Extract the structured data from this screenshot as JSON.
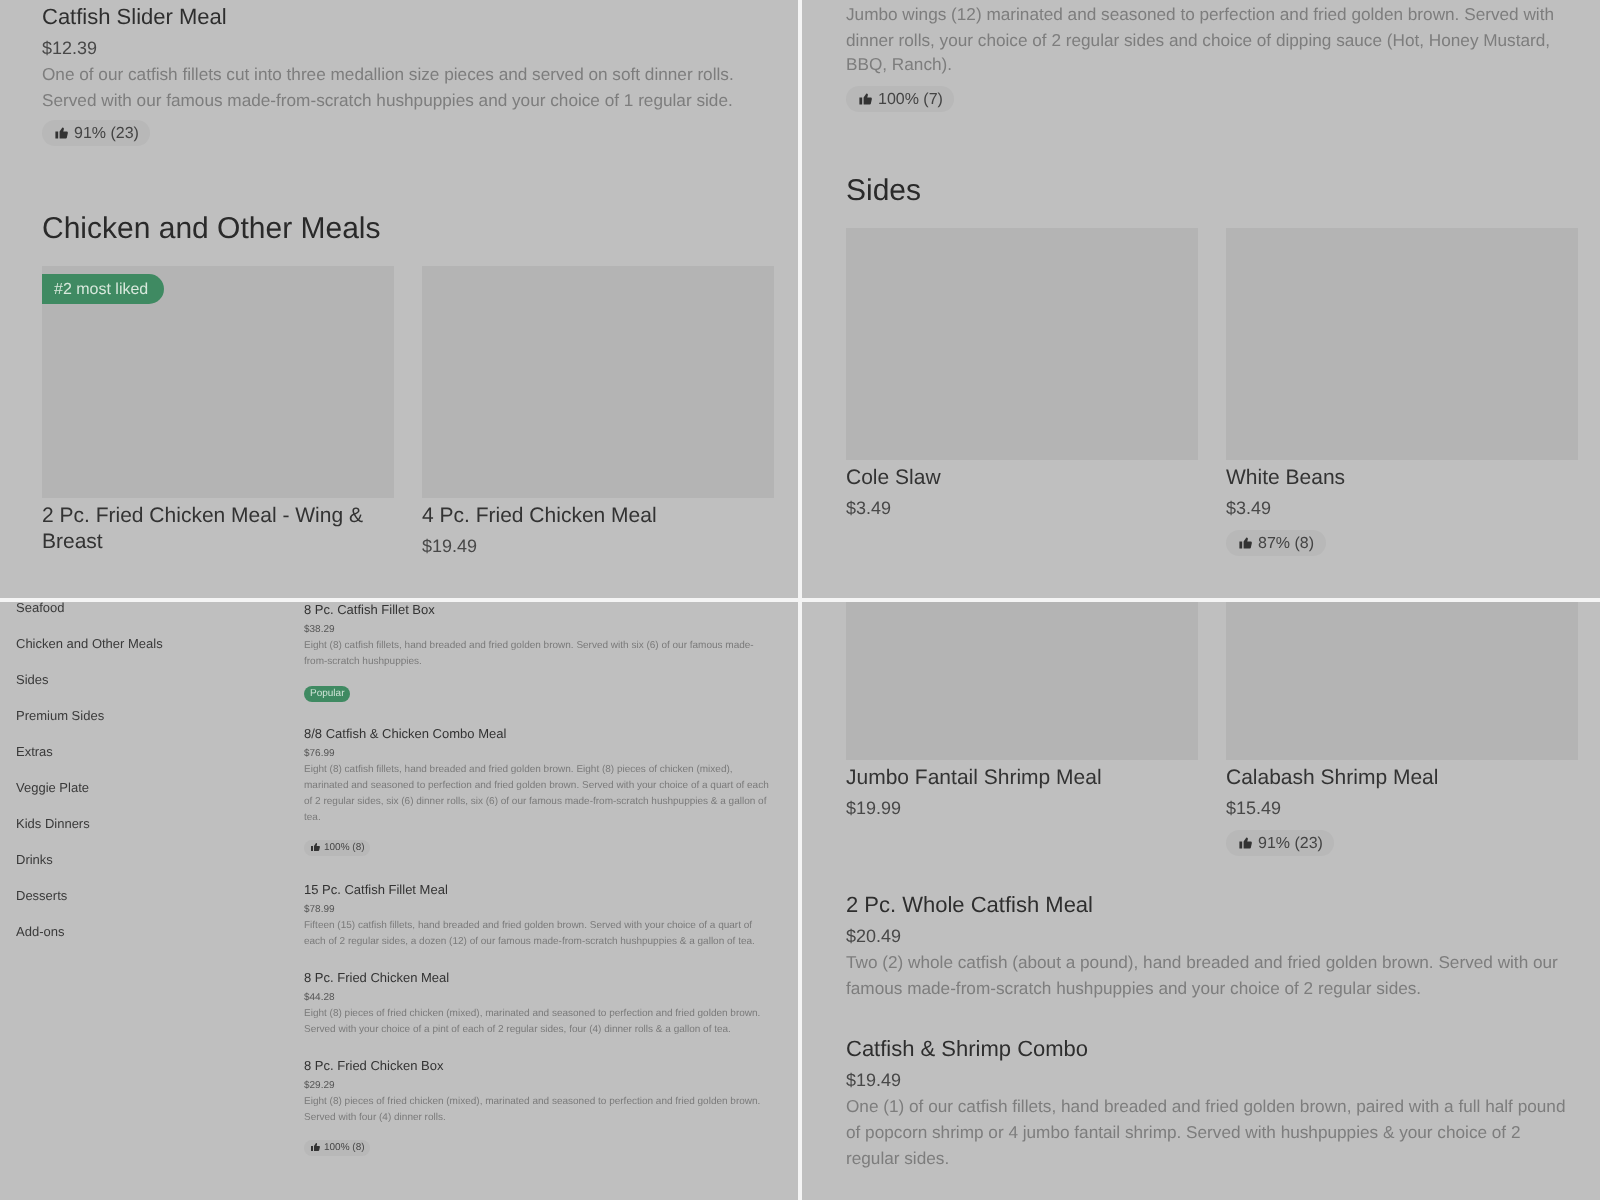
{
  "panels": [
    {
      "kind": "menu",
      "blocks": [
        {
          "kind": "item",
          "name": "Catfish Slider Meal",
          "price": "$12.39",
          "description": "One of our catfish fillets cut into three medallion size pieces and served on soft dinner rolls. Served with our famous made-from-scratch hushpuppies and your choice of 1 regular side.",
          "rating": "91% (23)"
        },
        {
          "kind": "heading",
          "text": "Chicken and Other Meals"
        },
        {
          "kind": "cards",
          "cards": [
            {
              "name": "2 Pc. Fried Chicken Meal - Wing & Breast",
              "badge": "#2 most liked"
            },
            {
              "name": "4 Pc. Fried Chicken Meal",
              "price": "$19.49"
            }
          ]
        }
      ]
    },
    {
      "kind": "menu",
      "blocks": [
        {
          "kind": "item",
          "description": "Jumbo wings (12) marinated and seasoned to perfection and fried golden brown. Served with dinner rolls, your choice of 2 regular sides and choice of dipping sauce (Hot, Honey Mustard, BBQ, Ranch).",
          "rating": "100% (7)"
        },
        {
          "kind": "heading",
          "text": "Sides"
        },
        {
          "kind": "cards",
          "cards": [
            {
              "name": "Cole Slaw",
              "price": "$3.49"
            },
            {
              "name": "White Beans",
              "price": "$3.49",
              "rating": "87% (8)"
            }
          ]
        }
      ]
    },
    {
      "kind": "compact",
      "categories": [
        "Seafood",
        "Chicken and Other Meals",
        "Sides",
        "Premium Sides",
        "Extras",
        "Veggie Plate",
        "Kids Dinners",
        "Drinks",
        "Desserts",
        "Add-ons"
      ],
      "items": [
        {
          "name": "8 Pc. Catfish Fillet Box",
          "price": "$38.29",
          "description": "Eight (8) catfish fillets, hand breaded and fried golden brown. Served with six (6) of our famous made-from-scratch hushpuppies.",
          "badge": "Popular"
        },
        {
          "name": "8/8 Catfish & Chicken Combo Meal",
          "price": "$76.99",
          "description": "Eight (8) catfish fillets, hand breaded and fried golden brown. Eight (8) pieces of chicken (mixed), marinated and seasoned to perfection and fried golden brown. Served with your choice of a quart of each of 2 regular sides, six (6) dinner rolls, six (6) of our famous made-from-scratch hushpuppies & a gallon of tea.",
          "rating": "100% (8)"
        },
        {
          "name": "15 Pc. Catfish Fillet Meal",
          "price": "$78.99",
          "description": "Fifteen (15) catfish fillets, hand breaded and fried golden brown. Served with your choice of a quart of each of 2 regular sides, a dozen (12) of our famous made-from-scratch hushpuppies & a gallon of tea."
        },
        {
          "name": "8 Pc. Fried Chicken Meal",
          "price": "$44.28",
          "description": "Eight (8) pieces of fried chicken (mixed), marinated and seasoned to perfection and fried golden brown. Served with your choice of a pint of each of 2 regular sides, four (4) dinner rolls & a gallon of tea."
        },
        {
          "name": "8 Pc. Fried Chicken Box",
          "price": "$29.29",
          "description": "Eight (8) pieces of fried chicken (mixed), marinated and seasoned to perfection and fried golden brown. Served with four (4) dinner rolls.",
          "rating": "100% (8)"
        }
      ]
    },
    {
      "kind": "menu",
      "blocks": [
        {
          "kind": "cards",
          "cards": [
            {
              "name": "Jumbo Fantail Shrimp Meal",
              "price": "$19.99"
            },
            {
              "name": "Calabash Shrimp Meal",
              "price": "$15.49",
              "rating": "91% (23)"
            }
          ]
        },
        {
          "kind": "item",
          "name": "2 Pc. Whole Catfish Meal",
          "price": "$20.49",
          "description": "Two (2) whole catfish (about a pound), hand breaded and fried golden brown. Served with our famous made-from-scratch hushpuppies and your choice of 2 regular sides."
        },
        {
          "kind": "item",
          "name": "Catfish & Shrimp Combo",
          "price": "$19.49",
          "description": "One (1) of our catfish fillets, hand breaded and fried golden brown, paired with a full half pound of popcorn shrimp or 4 jumbo fantail shrimp. Served with hushpuppies & your choice of 2 regular sides."
        }
      ]
    }
  ]
}
